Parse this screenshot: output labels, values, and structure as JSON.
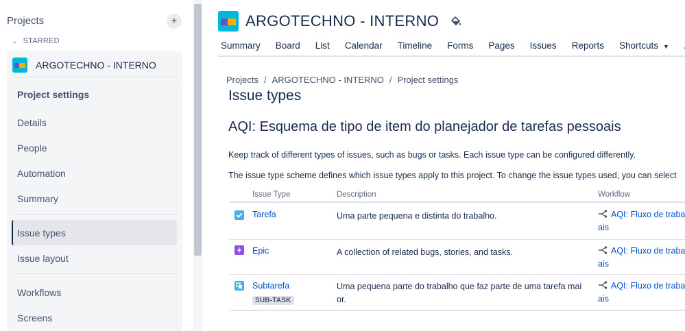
{
  "sidebar": {
    "header": "Projects",
    "add_label": "+",
    "starred_label": "STARRED",
    "project_name": "ARGOTECHNO - INTERNO",
    "section_title": "Project settings",
    "items": [
      {
        "label": "Details"
      },
      {
        "label": "People"
      },
      {
        "label": "Automation"
      },
      {
        "label": "Summary"
      },
      {
        "label": "Issue types",
        "active": true
      },
      {
        "label": "Issue layout"
      },
      {
        "label": "Workflows"
      },
      {
        "label": "Screens"
      }
    ]
  },
  "header": {
    "project_name": "ARGOTECHNO - INTERNO",
    "tabs": [
      "Summary",
      "Board",
      "List",
      "Calendar",
      "Timeline",
      "Forms",
      "Pages",
      "Issues",
      "Reports",
      "Shortcuts",
      "A"
    ]
  },
  "breadcrumb": [
    "Projects",
    "ARGOTECHNO - INTERNO",
    "Project settings"
  ],
  "page_title": "Issue types",
  "scheme_title": "AQI: Esquema de tipo de item do planejador de tarefas pessoais",
  "paragraphs": [
    "Keep track of different types of issues, such as bugs or tasks. Each issue type can be configured differently.",
    "The issue type scheme defines which issue types apply to this project. To change the issue types used, you can select"
  ],
  "table": {
    "headers": [
      "Issue Type",
      "Description",
      "Workflow"
    ],
    "rows": [
      {
        "name": "Tarefa",
        "icon": "task-icon",
        "icon_color": "#4bade8",
        "description": "Uma parte pequena e distinta do trabalho.",
        "workflow": "AQI: Fluxo de traba ais",
        "badge": ""
      },
      {
        "name": "Epic",
        "icon": "epic-icon",
        "icon_color": "#904ee2",
        "description": "A collection of related bugs, stories, and tasks.",
        "workflow": "AQI: Fluxo de traba ais",
        "badge": ""
      },
      {
        "name": "Subtarefa",
        "icon": "subtask-icon",
        "icon_color": "#4bade8",
        "description": "Uma pequena parte do trabalho que faz parte de uma tarefa mai or.",
        "workflow": "AQI: Fluxo de traba ais",
        "badge": "SUB-TASK"
      }
    ]
  },
  "colors": {
    "accent": "#0052cc",
    "sidebar_bg": "#f4f5f7",
    "project_icon_bg": "#00b8d9"
  }
}
